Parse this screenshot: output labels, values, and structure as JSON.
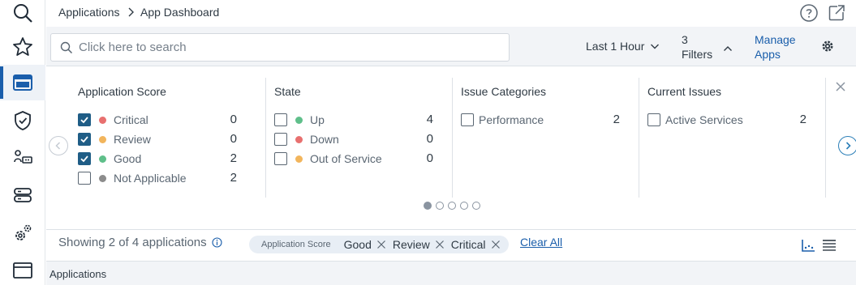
{
  "breadcrumb": {
    "root": "Applications",
    "current": "App Dashboard"
  },
  "search": {
    "placeholder": "Click here to search",
    "value": ""
  },
  "toolbar": {
    "timeframe": "Last 1 Hour",
    "filters_count": "3",
    "filters_label": "Filters",
    "manage_line1": "Manage",
    "manage_line2": "Apps"
  },
  "filter_groups": {
    "app_score": {
      "title": "Application Score",
      "items": [
        {
          "label": "Critical",
          "count": "0",
          "checked": true,
          "color": "#e8706f"
        },
        {
          "label": "Review",
          "count": "0",
          "checked": true,
          "color": "#f2b55c"
        },
        {
          "label": "Good",
          "count": "2",
          "checked": true,
          "color": "#5fbf8a"
        },
        {
          "label": "Not Applicable",
          "count": "2",
          "checked": false,
          "color": "#8c8c8c"
        }
      ]
    },
    "state": {
      "title": "State",
      "items": [
        {
          "label": "Up",
          "count": "4",
          "checked": false,
          "color": "#5fbf8a"
        },
        {
          "label": "Down",
          "count": "0",
          "checked": false,
          "color": "#e8706f"
        },
        {
          "label": "Out of Service",
          "count": "0",
          "checked": false,
          "color": "#f2b55c"
        }
      ]
    },
    "issue_categories": {
      "title": "Issue Categories",
      "items": [
        {
          "label": "Performance",
          "count": "2",
          "checked": false
        }
      ]
    },
    "current_issues": {
      "title": "Current Issues",
      "items": [
        {
          "label": "Active Services",
          "count": "2",
          "checked": false
        }
      ]
    }
  },
  "pager": {
    "pages": 5,
    "active": 1
  },
  "results": {
    "showing": "Showing 2 of 4 applications",
    "chip_label": "Application Score",
    "chips": [
      "Good",
      "Review",
      "Critical"
    ],
    "clear_all": "Clear All"
  },
  "table": {
    "header": "Applications"
  },
  "colors": {
    "accent": "#1a5eab",
    "checkbox": "#1f5d86",
    "toolbar_bg": "#f2f4f7"
  },
  "icons": {
    "rail": [
      "search-icon",
      "star-icon",
      "applications-icon",
      "shield-check-icon",
      "network-icon",
      "servers-icon",
      "settings-gears-icon",
      "window-icon"
    ]
  }
}
